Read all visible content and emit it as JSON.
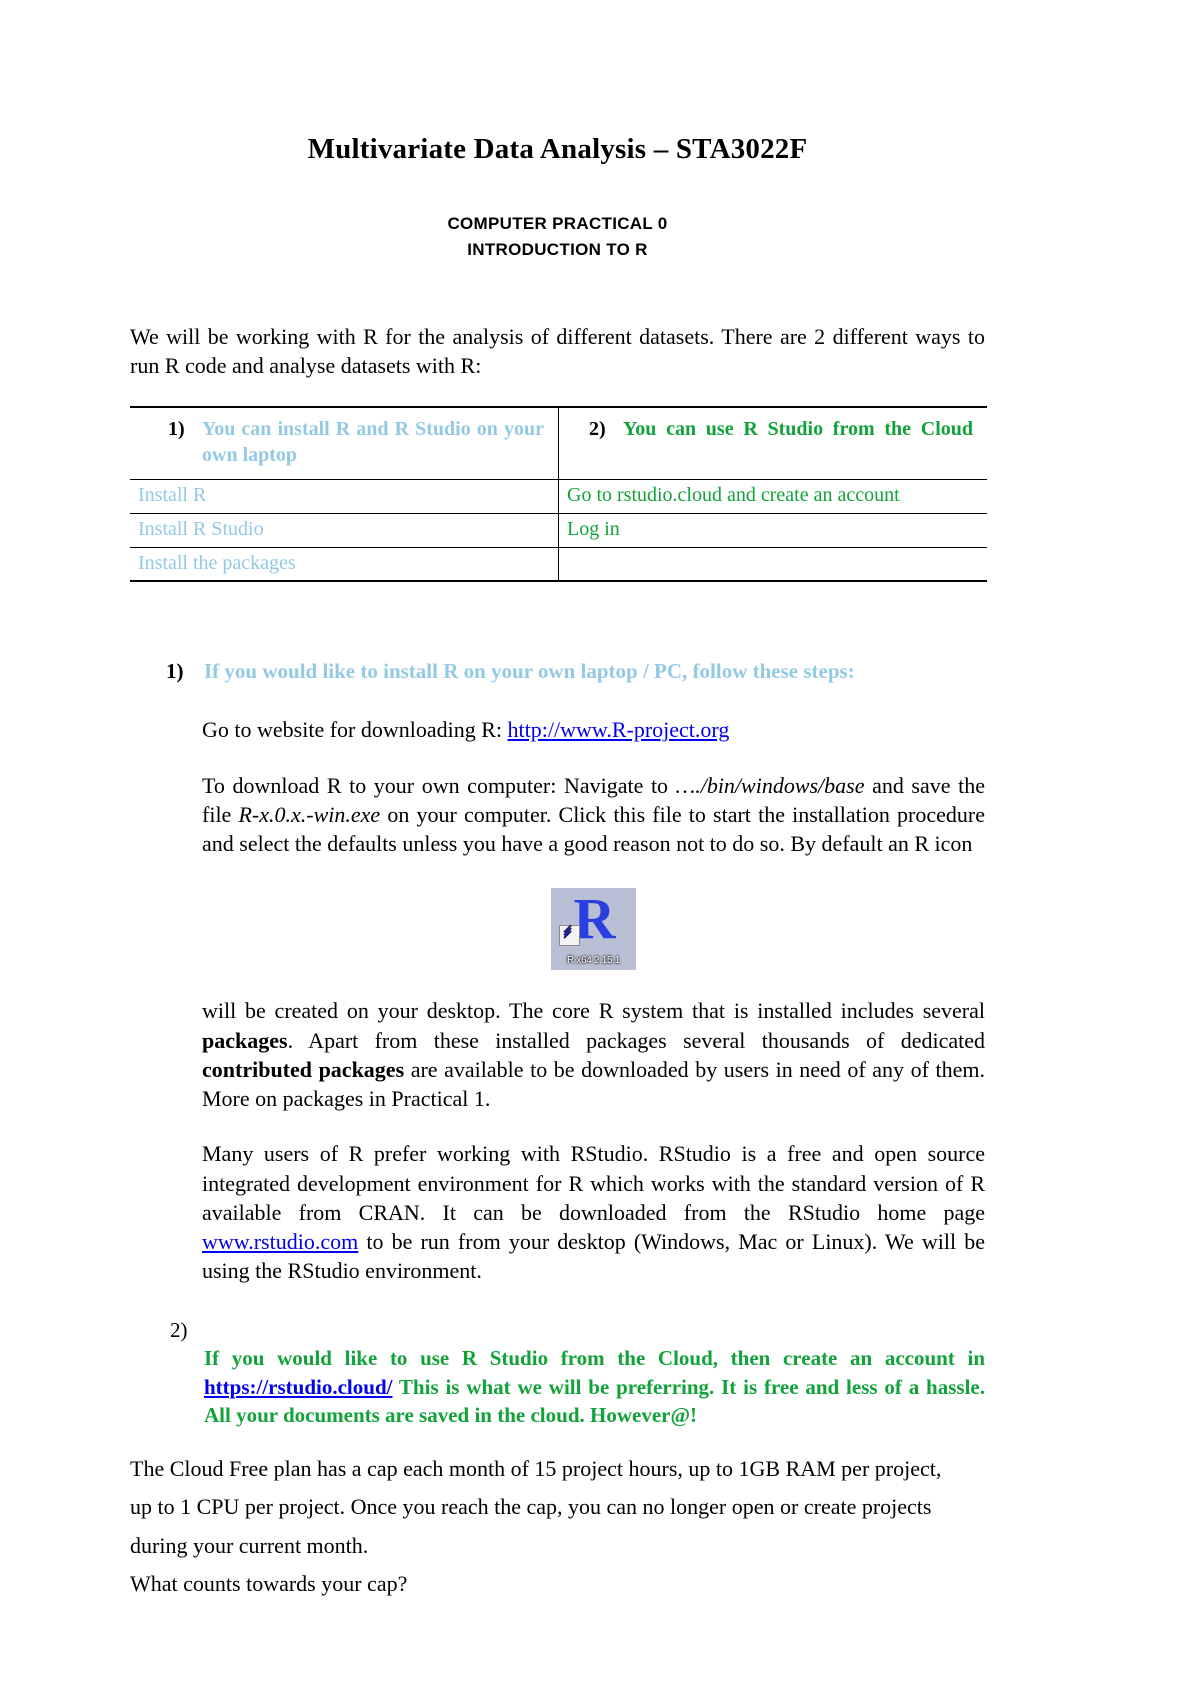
{
  "document": {
    "title": "Multivariate Data Analysis – STA3022F",
    "subtitle_line1": "COMPUTER PRACTICAL 0",
    "subtitle_line2": "INTRODUCTION TO R",
    "intro": "We will be working with R for the analysis of different datasets. There are 2 different ways to run R code and analyse datasets with R:"
  },
  "table": {
    "header_left_number": "1)",
    "header_left_text": "You can install R and R Studio on your own laptop",
    "header_right_number": "2)",
    "header_right_text": "You can use R Studio from the Cloud",
    "rows": [
      {
        "left": "Install R",
        "right": "Go to rstudio.cloud and create an account"
      },
      {
        "left": "Install R Studio",
        "right": "Log in"
      },
      {
        "left": "Install the packages",
        "right": ""
      }
    ],
    "colors": {
      "left": "#93c9e3",
      "right": "#11a23a"
    }
  },
  "section1": {
    "marker": "1)",
    "heading": "If you would like to install R on your own laptop / PC, follow these steps:",
    "download_label": "Go to website for downloading R:",
    "download_link": "http://www.R-project.org",
    "para_download_a": "To download R to your own computer:  Navigate to ",
    "para_download_path": "…./bin/windows/base",
    "para_download_b": " and save the file ",
    "para_download_file": "R-x.0.x.-win.exe",
    "para_download_c": " on your computer. Click this file to start the installation procedure and select the defaults unless you have a good reason not to do so. By default an R icon",
    "r_icon_label": "R x64 2.15.1",
    "r_icon_glyph": "R",
    "para_after_icon_a": "will be created on your desktop. The core R system that is installed includes several ",
    "para_after_icon_bold1": "packages",
    "para_after_icon_b": ". Apart from these installed packages several thousands of dedicated ",
    "para_after_icon_bold2": "contributed packages",
    "para_after_icon_c": " are available to be downloaded by users in need of any of them. More on packages in Practical 1.",
    "para_rstudio_a": "Many users of R prefer working with RStudio.  RStudio is a free and open source integrated development environment for R which works with the standard version of R available from CRAN. It can be downloaded from the RStudio home page ",
    "para_rstudio_link": "www.rstudio.com",
    "para_rstudio_b": "  to be run from your desktop (Windows, Mac or Linux). We will be using the RStudio environment."
  },
  "section2": {
    "marker": "2)",
    "text_a": "If you would like to use R Studio from the Cloud, then create an account in ",
    "link": "https://rstudio.cloud/",
    "text_b": "  This is what we will be preferring. It is free and less of a hassle. All your documents are saved in the cloud. However@!",
    "color": "#11a23a"
  },
  "tail": {
    "line1": "The Cloud Free plan has a cap each month of 15 project hours, up to 1GB RAM per project,",
    "line2": "up to 1 CPU per project. Once you reach the cap, you can no longer open or create projects",
    "line3": "during your current month.",
    "line4": "What counts towards your cap?"
  }
}
